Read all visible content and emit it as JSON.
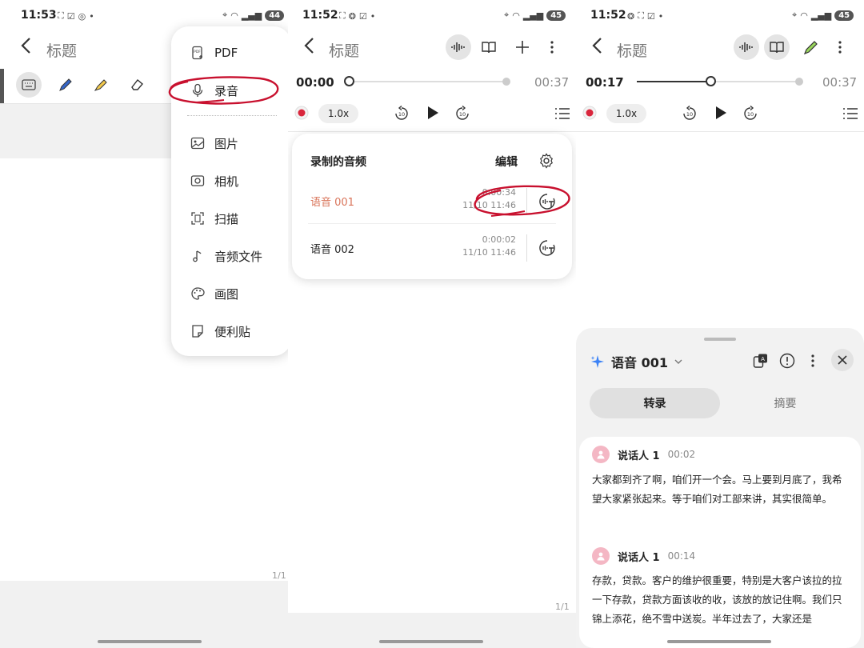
{
  "panel1": {
    "status": {
      "time": "11:53",
      "battery": "44"
    },
    "title": "标题",
    "page_indicator": "1/1",
    "menu": {
      "items": [
        {
          "label": "PDF",
          "icon": "pdf-icon"
        },
        {
          "label": "录音",
          "icon": "microphone-icon"
        },
        {
          "label": "图片",
          "icon": "image-icon"
        },
        {
          "label": "相机",
          "icon": "camera-icon"
        },
        {
          "label": "扫描",
          "icon": "scan-icon"
        },
        {
          "label": "音频文件",
          "icon": "music-note-icon"
        },
        {
          "label": "画图",
          "icon": "palette-icon"
        },
        {
          "label": "便利贴",
          "icon": "sticky-note-icon"
        }
      ]
    }
  },
  "panel2": {
    "status": {
      "time": "11:52",
      "battery": "45"
    },
    "title": "标题",
    "player": {
      "current": "00:00",
      "total": "00:37",
      "speed": "1.0x",
      "progress": 0.0
    },
    "recordings": {
      "header": "录制的音频",
      "edit": "编辑",
      "items": [
        {
          "name": "语音 001",
          "duration": "0:00:34",
          "date": "11/10 11:46",
          "active": true
        },
        {
          "name": "语音 002",
          "duration": "0:00:02",
          "date": "11/10 11:46",
          "active": false
        }
      ]
    },
    "page_indicator": "1/1"
  },
  "panel3": {
    "status": {
      "time": "11:52",
      "battery": "45"
    },
    "title": "标题",
    "player": {
      "current": "00:17",
      "total": "00:37",
      "speed": "1.0x",
      "progress": 0.46
    },
    "sheet": {
      "title": "语音 001",
      "tabs": {
        "transcript": "转录",
        "summary": "摘要"
      },
      "entries": [
        {
          "speaker": "说话人 1",
          "time": "00:02",
          "text": "大家都到齐了啊，咱们开一个会。马上要到月底了，我希望大家紧张起来。等于咱们对工部来讲，其实很简单。"
        },
        {
          "speaker": "说话人 1",
          "time": "00:14",
          "text": "存款，贷款。客户的维护很重要，特别是大客户该拉的拉一下存款，贷款方面该收的收，该放的放记住啊。我们只锦上添花，绝不雪中送炭。半年过去了，大家还是"
        }
      ]
    }
  },
  "colors": {
    "accent_red": "#d9263c",
    "active_orange": "#d9745a",
    "handwriting_red": "#c8102e",
    "sparkle_blue": "#3b82f6"
  }
}
